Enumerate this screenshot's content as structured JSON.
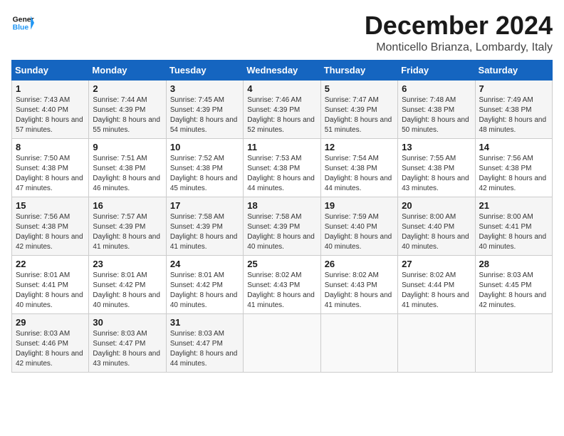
{
  "header": {
    "logo_line1": "General",
    "logo_line2": "Blue",
    "title": "December 2024",
    "subtitle": "Monticello Brianza, Lombardy, Italy"
  },
  "weekdays": [
    "Sunday",
    "Monday",
    "Tuesday",
    "Wednesday",
    "Thursday",
    "Friday",
    "Saturday"
  ],
  "weeks": [
    [
      {
        "day": "1",
        "rise": "7:43 AM",
        "set": "4:40 PM",
        "daylight": "8 hours and 57 minutes."
      },
      {
        "day": "2",
        "rise": "7:44 AM",
        "set": "4:39 PM",
        "daylight": "8 hours and 55 minutes."
      },
      {
        "day": "3",
        "rise": "7:45 AM",
        "set": "4:39 PM",
        "daylight": "8 hours and 54 minutes."
      },
      {
        "day": "4",
        "rise": "7:46 AM",
        "set": "4:39 PM",
        "daylight": "8 hours and 52 minutes."
      },
      {
        "day": "5",
        "rise": "7:47 AM",
        "set": "4:39 PM",
        "daylight": "8 hours and 51 minutes."
      },
      {
        "day": "6",
        "rise": "7:48 AM",
        "set": "4:38 PM",
        "daylight": "8 hours and 50 minutes."
      },
      {
        "day": "7",
        "rise": "7:49 AM",
        "set": "4:38 PM",
        "daylight": "8 hours and 48 minutes."
      }
    ],
    [
      {
        "day": "8",
        "rise": "7:50 AM",
        "set": "4:38 PM",
        "daylight": "8 hours and 47 minutes."
      },
      {
        "day": "9",
        "rise": "7:51 AM",
        "set": "4:38 PM",
        "daylight": "8 hours and 46 minutes."
      },
      {
        "day": "10",
        "rise": "7:52 AM",
        "set": "4:38 PM",
        "daylight": "8 hours and 45 minutes."
      },
      {
        "day": "11",
        "rise": "7:53 AM",
        "set": "4:38 PM",
        "daylight": "8 hours and 44 minutes."
      },
      {
        "day": "12",
        "rise": "7:54 AM",
        "set": "4:38 PM",
        "daylight": "8 hours and 44 minutes."
      },
      {
        "day": "13",
        "rise": "7:55 AM",
        "set": "4:38 PM",
        "daylight": "8 hours and 43 minutes."
      },
      {
        "day": "14",
        "rise": "7:56 AM",
        "set": "4:38 PM",
        "daylight": "8 hours and 42 minutes."
      }
    ],
    [
      {
        "day": "15",
        "rise": "7:56 AM",
        "set": "4:38 PM",
        "daylight": "8 hours and 42 minutes."
      },
      {
        "day": "16",
        "rise": "7:57 AM",
        "set": "4:39 PM",
        "daylight": "8 hours and 41 minutes."
      },
      {
        "day": "17",
        "rise": "7:58 AM",
        "set": "4:39 PM",
        "daylight": "8 hours and 41 minutes."
      },
      {
        "day": "18",
        "rise": "7:58 AM",
        "set": "4:39 PM",
        "daylight": "8 hours and 40 minutes."
      },
      {
        "day": "19",
        "rise": "7:59 AM",
        "set": "4:40 PM",
        "daylight": "8 hours and 40 minutes."
      },
      {
        "day": "20",
        "rise": "8:00 AM",
        "set": "4:40 PM",
        "daylight": "8 hours and 40 minutes."
      },
      {
        "day": "21",
        "rise": "8:00 AM",
        "set": "4:41 PM",
        "daylight": "8 hours and 40 minutes."
      }
    ],
    [
      {
        "day": "22",
        "rise": "8:01 AM",
        "set": "4:41 PM",
        "daylight": "8 hours and 40 minutes."
      },
      {
        "day": "23",
        "rise": "8:01 AM",
        "set": "4:42 PM",
        "daylight": "8 hours and 40 minutes."
      },
      {
        "day": "24",
        "rise": "8:01 AM",
        "set": "4:42 PM",
        "daylight": "8 hours and 40 minutes."
      },
      {
        "day": "25",
        "rise": "8:02 AM",
        "set": "4:43 PM",
        "daylight": "8 hours and 41 minutes."
      },
      {
        "day": "26",
        "rise": "8:02 AM",
        "set": "4:43 PM",
        "daylight": "8 hours and 41 minutes."
      },
      {
        "day": "27",
        "rise": "8:02 AM",
        "set": "4:44 PM",
        "daylight": "8 hours and 41 minutes."
      },
      {
        "day": "28",
        "rise": "8:03 AM",
        "set": "4:45 PM",
        "daylight": "8 hours and 42 minutes."
      }
    ],
    [
      {
        "day": "29",
        "rise": "8:03 AM",
        "set": "4:46 PM",
        "daylight": "8 hours and 42 minutes."
      },
      {
        "day": "30",
        "rise": "8:03 AM",
        "set": "4:47 PM",
        "daylight": "8 hours and 43 minutes."
      },
      {
        "day": "31",
        "rise": "8:03 AM",
        "set": "4:47 PM",
        "daylight": "8 hours and 44 minutes."
      },
      null,
      null,
      null,
      null
    ]
  ]
}
